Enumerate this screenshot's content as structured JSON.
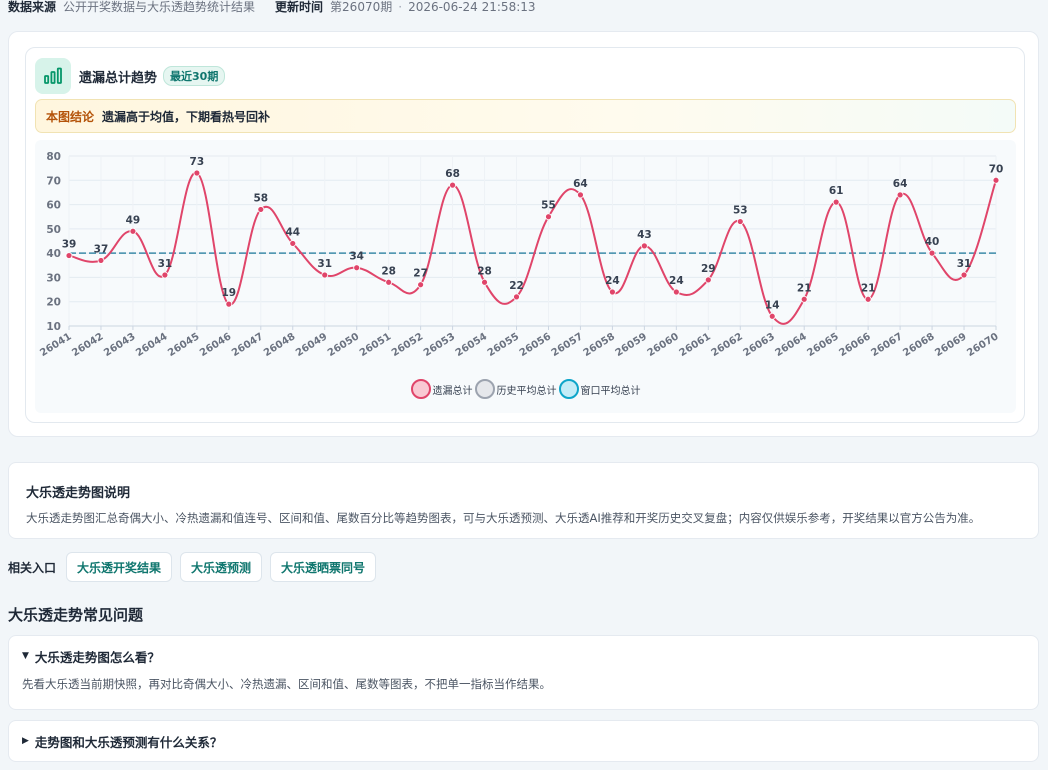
{
  "meta": {
    "source_label": "数据来源",
    "source_value": "公开开奖数据与大乐透趋势统计结果",
    "update_label": "更新时间",
    "update_issue": "第26070期",
    "dot": "·",
    "update_time": "2026-06-24 21:58:13"
  },
  "chart_card": {
    "icon": "bar-chart-icon",
    "title": "遗漏总计趋势",
    "badge": "最近30期",
    "conclusion_label": "本图结论",
    "conclusion_text": "遗漏高于均值，下期看热号回补"
  },
  "chart_data": {
    "type": "line",
    "categories": [
      "26041",
      "26042",
      "26043",
      "26044",
      "26045",
      "26046",
      "26047",
      "26048",
      "26049",
      "26050",
      "26051",
      "26052",
      "26053",
      "26054",
      "26055",
      "26056",
      "26057",
      "26058",
      "26059",
      "26060",
      "26061",
      "26062",
      "26063",
      "26064",
      "26065",
      "26066",
      "26067",
      "26068",
      "26069",
      "26070"
    ],
    "series": [
      {
        "name": "遗漏总计",
        "color": "#e0456a",
        "values": [
          39,
          37,
          49,
          31,
          73,
          19,
          58,
          44,
          31,
          34,
          28,
          27,
          68,
          28,
          22,
          55,
          64,
          24,
          43,
          24,
          29,
          53,
          14,
          21,
          61,
          21,
          64,
          40,
          31,
          70
        ]
      },
      {
        "name": "历史平均总计",
        "color": "#9ca3af",
        "values": []
      },
      {
        "name": "窗口平均总计",
        "color": "#0ea5c9",
        "values": []
      }
    ],
    "average_line": 40,
    "yticks": [
      10,
      20,
      30,
      40,
      50,
      60,
      70,
      80
    ],
    "ylim": [
      10,
      80
    ],
    "grid": true,
    "legend": "bottom-center"
  },
  "explain": {
    "title": "大乐透走势图说明",
    "text": "大乐透走势图汇总奇偶大小、冷热遗漏和值连号、区间和值、尾数百分比等趋势图表，可与大乐透预测、大乐透AI推荐和开奖历史交叉复盘；内容仅供娱乐参考，开奖结果以官方公告为准。"
  },
  "related": {
    "label": "相关入口",
    "links": [
      "大乐透开奖结果",
      "大乐透预测",
      "大乐透晒票同号"
    ]
  },
  "faq": {
    "heading": "大乐透走势常见问题",
    "items": [
      {
        "marker": "▼",
        "question": "大乐透走势图怎么看？",
        "answer": "先看大乐透当前期快照，再对比奇偶大小、冷热遗漏、区间和值、尾数等图表，不把单一指标当作结果。"
      },
      {
        "marker": "▶",
        "question": "走势图和大乐透预测有什么关系？"
      }
    ]
  }
}
